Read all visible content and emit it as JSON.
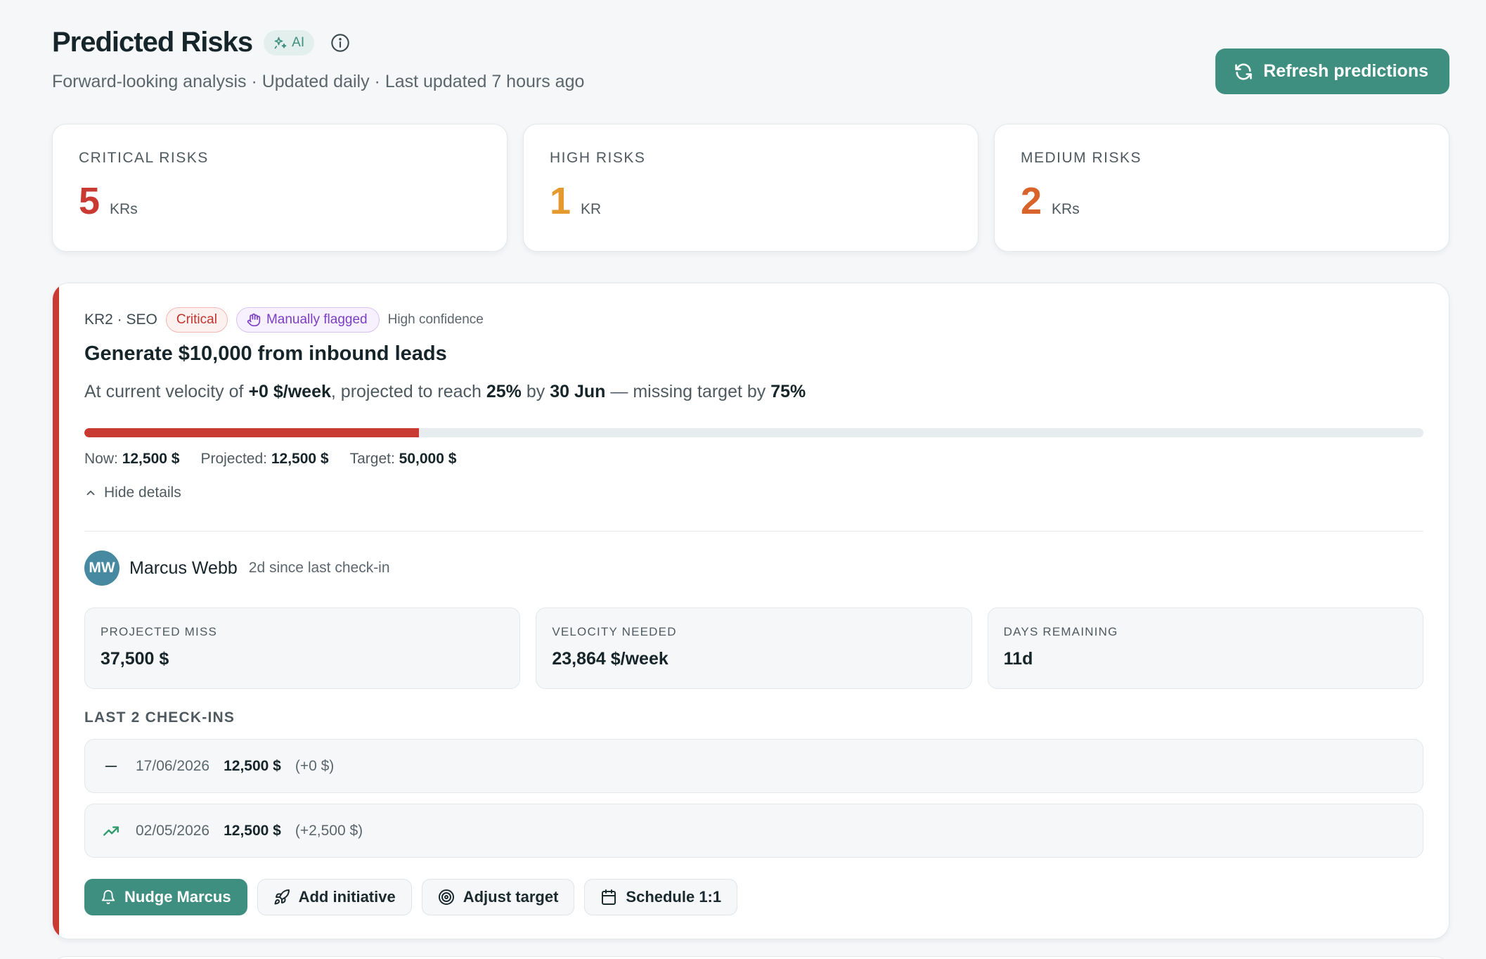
{
  "header": {
    "title": "Predicted Risks",
    "ai_badge": "AI",
    "subtitle": "Forward-looking analysis · Updated daily · Last updated 7 hours ago",
    "refresh_label": "Refresh predictions"
  },
  "stats": [
    {
      "label": "CRITICAL RISKS",
      "value": "5",
      "unit": "KRs",
      "color": "#c93a33"
    },
    {
      "label": "HIGH RISKS",
      "value": "1",
      "unit": "KR",
      "color": "#e59a2f"
    },
    {
      "label": "MEDIUM RISKS",
      "value": "2",
      "unit": "KRs",
      "color": "#d8632b"
    }
  ],
  "risk": {
    "kr_ref": "KR2 · SEO",
    "severity": "Critical",
    "flag": "Manually flagged",
    "confidence": "High confidence",
    "title": "Generate $10,000 from inbound leads",
    "projection": {
      "p1": "At current velocity of ",
      "velocity": "+0 $/week",
      "p2": ", projected to reach ",
      "pct": "25%",
      "p3": " by ",
      "date": "30 Jun",
      "p4": " — missing target by ",
      "miss": "75%"
    },
    "progress_fraction": 0.25,
    "now_label": "Now:",
    "now_value": "12,500 $",
    "projected_label": "Projected:",
    "projected_value": "12,500 $",
    "target_label": "Target:",
    "target_value": "50,000 $",
    "hide_details": "Hide details",
    "owner": {
      "initials": "MW",
      "name": "Marcus Webb",
      "meta": "2d since last check-in"
    },
    "metrics": [
      {
        "label": "PROJECTED MISS",
        "value": "37,500 $"
      },
      {
        "label": "VELOCITY NEEDED",
        "value": "23,864 $/week"
      },
      {
        "label": "DAYS REMAINING",
        "value": "11d"
      }
    ],
    "checkins_label": "LAST 2 CHECK-INS",
    "checkins": [
      {
        "trend": "flat",
        "date": "17/06/2026",
        "value": "12,500 $",
        "delta": "(+0 $)"
      },
      {
        "trend": "up",
        "date": "02/05/2026",
        "value": "12,500 $",
        "delta": "(+2,500 $)"
      }
    ],
    "actions": {
      "nudge": "Nudge Marcus",
      "initiative": "Add initiative",
      "adjust": "Adjust target",
      "schedule": "Schedule 1:1"
    }
  }
}
